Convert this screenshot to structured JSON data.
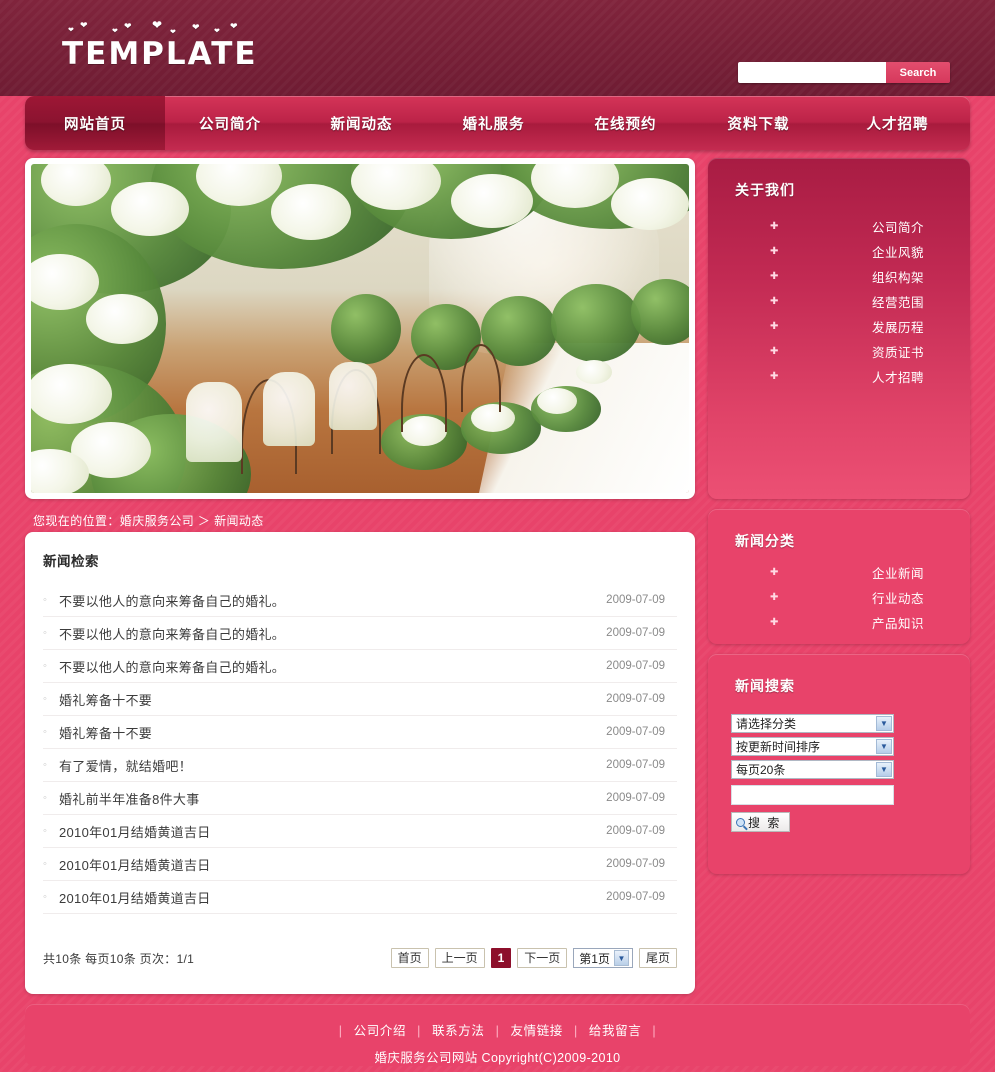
{
  "header": {
    "logo_text": "TEMPLATE",
    "search": {
      "value": "",
      "placeholder": "",
      "button_label": "Search"
    }
  },
  "nav": {
    "items": [
      {
        "label": "网站首页",
        "active": true
      },
      {
        "label": "公司简介",
        "active": false
      },
      {
        "label": "新闻动态",
        "active": false
      },
      {
        "label": "婚礼服务",
        "active": false
      },
      {
        "label": "在线预约",
        "active": false
      },
      {
        "label": "资料下载",
        "active": false
      },
      {
        "label": "人才招聘",
        "active": false
      }
    ]
  },
  "banner": {
    "alt": "wedding-venue-flower-archway-photo"
  },
  "breadcrumb": {
    "text": "您现在的位置：婚庆服务公司 ＞ 新闻动态"
  },
  "main": {
    "title": "新闻检索",
    "news": [
      {
        "title": "不要以他人的意向来筹备自己的婚礼。",
        "date": "2009-07-09"
      },
      {
        "title": "不要以他人的意向来筹备自己的婚礼。",
        "date": "2009-07-09"
      },
      {
        "title": "不要以他人的意向来筹备自己的婚礼。",
        "date": "2009-07-09"
      },
      {
        "title": "婚礼筹备十不要",
        "date": "2009-07-09"
      },
      {
        "title": "婚礼筹备十不要",
        "date": "2009-07-09"
      },
      {
        "title": "有了爱情，就结婚吧！",
        "date": "2009-07-09"
      },
      {
        "title": "婚礼前半年准备8件大事",
        "date": "2009-07-09"
      },
      {
        "title": "2010年01月结婚黄道吉日",
        "date": "2009-07-09"
      },
      {
        "title": "2010年01月结婚黄道吉日",
        "date": "2009-07-09"
      },
      {
        "title": "2010年01月结婚黄道吉日",
        "date": "2009-07-09"
      }
    ],
    "pager": {
      "info": "共10条 每页10条 页次：1/1",
      "first": "首页",
      "prev": "上一页",
      "current": "1",
      "next": "下一页",
      "jump_value": "第1页",
      "last": "尾页"
    }
  },
  "sidebar": {
    "about": {
      "title": "关于我们",
      "items": [
        {
          "label": "公司简介"
        },
        {
          "label": "企业风貌"
        },
        {
          "label": "组织构架"
        },
        {
          "label": "经营范围"
        },
        {
          "label": "发展历程"
        },
        {
          "label": "资质证书"
        },
        {
          "label": "人才招聘"
        }
      ]
    },
    "categories": {
      "title": "新闻分类",
      "items": [
        {
          "label": "企业新闻"
        },
        {
          "label": "行业动态"
        },
        {
          "label": "产品知识"
        }
      ]
    },
    "news_search": {
      "title": "新闻搜索",
      "category_value": "请选择分类",
      "sort_value": "按更新时间排序",
      "pagesize_value": "每页20条",
      "keyword_value": "",
      "keyword_placeholder": "",
      "button_label": "搜 索"
    }
  },
  "footer": {
    "links": [
      {
        "label": "公司介绍"
      },
      {
        "label": "联系方法"
      },
      {
        "label": "友情链接"
      },
      {
        "label": "给我留言"
      }
    ],
    "copyright": "婚庆服务公司网站 Copyright(C)2009-2010"
  },
  "colors": {
    "background": "#e8436a",
    "header": "#7b2139",
    "nav_active": "#8b1330",
    "accent": "#d6385c",
    "pager_current": "#8d0f2b"
  }
}
